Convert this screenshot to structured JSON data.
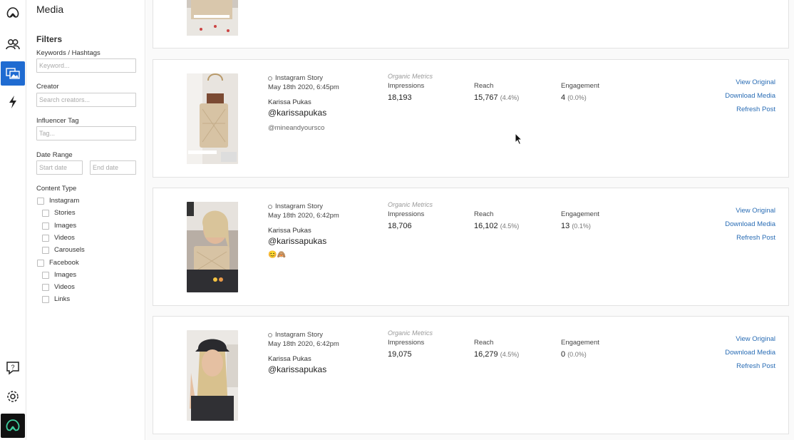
{
  "nav": {
    "logo_icon": "brand-logo-icon",
    "items": [
      {
        "icon": "people-icon",
        "active": false
      },
      {
        "icon": "media-icon",
        "active": true
      },
      {
        "icon": "lightning-icon",
        "active": false
      }
    ],
    "bottom": [
      {
        "icon": "help-chat-icon"
      },
      {
        "icon": "gear-icon"
      },
      {
        "icon": "avatar-logo-icon"
      }
    ],
    "accent_color": "#1f6bd1"
  },
  "sidebar": {
    "page_title": "Media",
    "filters_title": "Filters",
    "keywords": {
      "label": "Keywords / Hashtags",
      "placeholder": "Keyword..."
    },
    "creator": {
      "label": "Creator",
      "placeholder": "Search creators..."
    },
    "influencer_tag": {
      "label": "Influencer Tag",
      "placeholder": "Tag..."
    },
    "date_range": {
      "label": "Date Range",
      "start_placeholder": "Start date",
      "end_placeholder": "End date"
    },
    "content_type": {
      "label": "Content Type",
      "instagram": "Instagram",
      "instagram_children": [
        "Stories",
        "Images",
        "Videos",
        "Carousels"
      ],
      "facebook": "Facebook",
      "facebook_children": [
        "Images",
        "Videos",
        "Links"
      ]
    }
  },
  "posts": [
    {
      "type": "Instagram Story",
      "date": "May 18th 2020, 6:45pm",
      "creator_name": "Karissa Pukas",
      "handle": "@karissapukas",
      "caption": "@mineandyoursco",
      "organic_label": "Organic Metrics",
      "impressions_label": "Impressions",
      "impressions": "18,193",
      "reach_label": "Reach",
      "reach": "15,767",
      "reach_pct": "(4.4%)",
      "engagement_label": "Engagement",
      "engagement": "4",
      "engagement_pct": "(0.0%)",
      "actions": [
        "View Original",
        "Download Media",
        "Refresh Post"
      ]
    },
    {
      "type": "Instagram Story",
      "date": "May 18th 2020, 6:42pm",
      "creator_name": "Karissa Pukas",
      "handle": "@karissapukas",
      "caption": "😊🙈",
      "organic_label": "Organic Metrics",
      "impressions_label": "Impressions",
      "impressions": "18,706",
      "reach_label": "Reach",
      "reach": "16,102",
      "reach_pct": "(4.5%)",
      "engagement_label": "Engagement",
      "engagement": "13",
      "engagement_pct": "(0.1%)",
      "actions": [
        "View Original",
        "Download Media",
        "Refresh Post"
      ]
    },
    {
      "type": "Instagram Story",
      "date": "May 18th 2020, 6:42pm",
      "creator_name": "Karissa Pukas",
      "handle": "@karissapukas",
      "organic_label": "Organic Metrics",
      "impressions_label": "Impressions",
      "impressions": "19,075",
      "reach_label": "Reach",
      "reach": "16,279",
      "reach_pct": "(4.5%)",
      "engagement_label": "Engagement",
      "engagement": "0",
      "engagement_pct": "(0.0%)",
      "actions": [
        "View Original",
        "Download Media",
        "Refresh Post"
      ]
    }
  ]
}
